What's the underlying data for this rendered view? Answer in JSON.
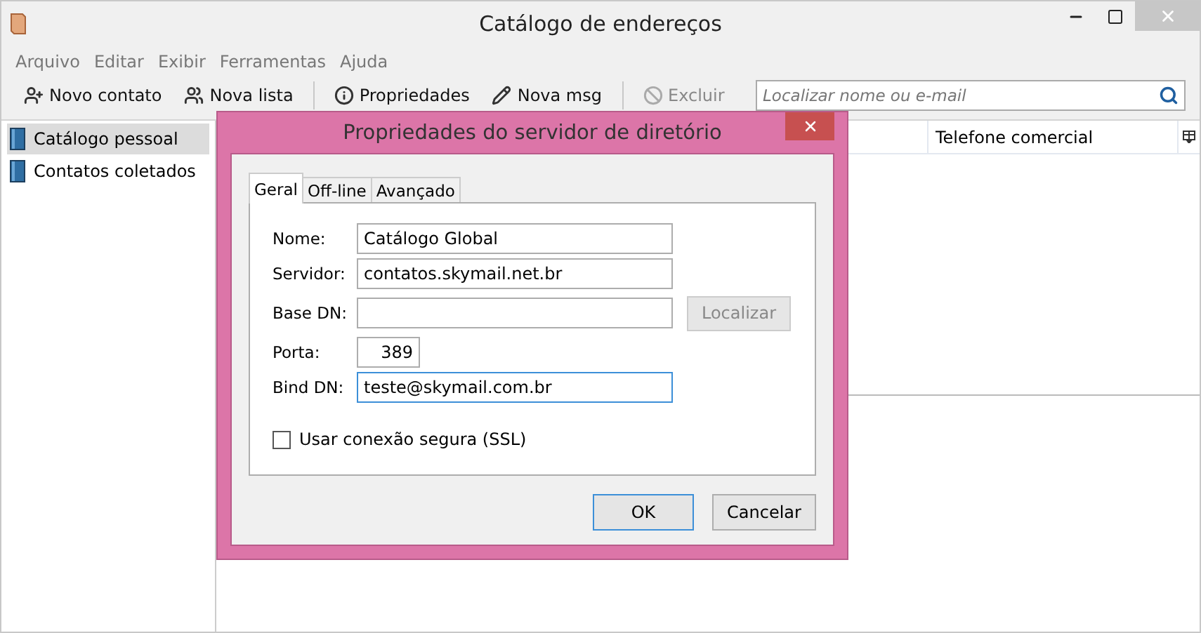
{
  "window": {
    "title": "Catálogo de endereços"
  },
  "menu": [
    "Arquivo",
    "Editar",
    "Exibir",
    "Ferramentas",
    "Ajuda"
  ],
  "toolbar": [
    {
      "label": "Novo contato",
      "disabled": false
    },
    {
      "label": "Nova lista",
      "disabled": false
    },
    {
      "label": "Propriedades",
      "disabled": false
    },
    {
      "label": "Nova msg",
      "disabled": false
    },
    {
      "label": "Excluir",
      "disabled": true
    }
  ],
  "search": {
    "placeholder": "Localizar nome ou e-mail"
  },
  "sidebar": {
    "items": [
      {
        "label": "Catálogo pessoal",
        "selected": true
      },
      {
        "label": "Contatos coletados",
        "selected": false
      }
    ]
  },
  "table": {
    "columns": [
      "Telefone comercial"
    ]
  },
  "dialog": {
    "title": "Propriedades do servidor de diretório",
    "tabs": [
      {
        "label": "Geral",
        "selected": true
      },
      {
        "label": "Off-line",
        "selected": false
      },
      {
        "label": "Avançado",
        "selected": false
      }
    ],
    "fields": [
      {
        "label": "Nome:",
        "value": "Catálogo Global",
        "kind": "wide",
        "focused": false
      },
      {
        "label": "Servidor:",
        "value": "contatos.skymail.net.br",
        "kind": "wide",
        "focused": false
      },
      {
        "label": "Base DN:",
        "kind": "lookup",
        "focused": false,
        "button": {
          "label": "Localizar",
          "disabled": true
        }
      },
      {
        "label": "Porta:",
        "value": "389",
        "kind": "port",
        "focused": false
      },
      {
        "label": "Bind DN:",
        "value": "teste@skymail.com.br",
        "kind": "wide",
        "focused": true
      }
    ],
    "checkbox": {
      "label": "Usar conexão segura (SSL)",
      "checked": false
    },
    "buttons": [
      {
        "label": "OK",
        "default": true
      },
      {
        "label": "Cancelar",
        "default": false
      }
    ]
  }
}
